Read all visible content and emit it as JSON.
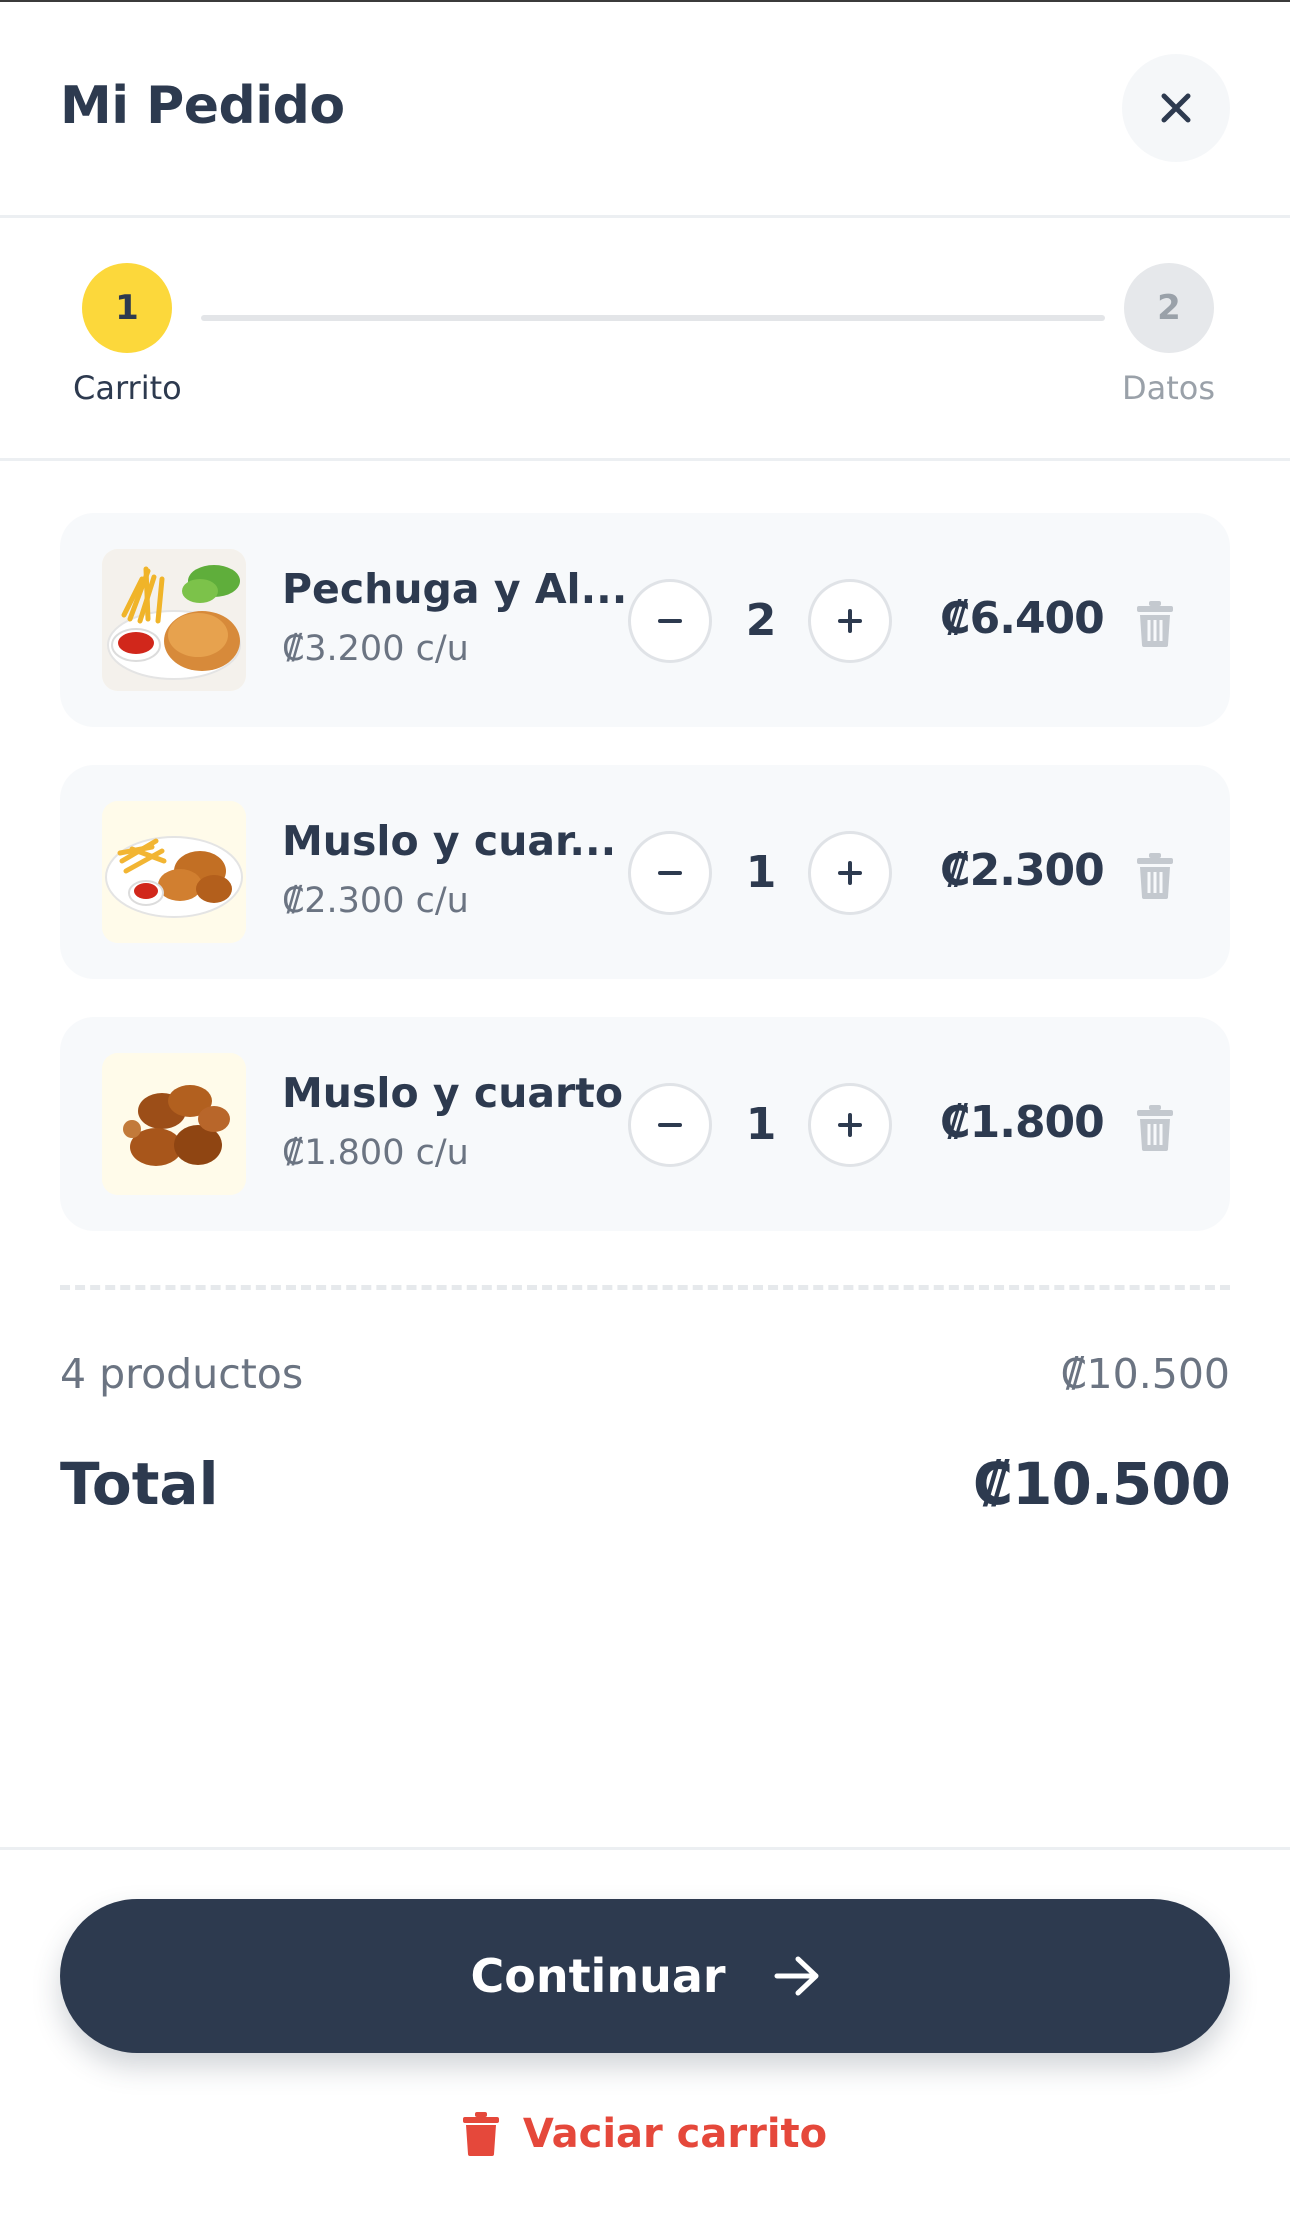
{
  "header": {
    "title": "Mi Pedido",
    "close_icon": "close-icon"
  },
  "stepper": {
    "steps": [
      {
        "number": "1",
        "label": "Carrito",
        "active": true,
        "color": "#fcd83b"
      },
      {
        "number": "2",
        "label": "Datos",
        "active": false,
        "color": "#e6e8eb"
      }
    ]
  },
  "cart": {
    "items": [
      {
        "name": "Pechuga y Al...",
        "unit_price": "₡3.200 c/u",
        "quantity": "2",
        "total": "₡6.400",
        "image": "chicken-breast-fries-icon"
      },
      {
        "name": "Muslo y cuar...",
        "unit_price": "₡2.300 c/u",
        "quantity": "1",
        "total": "₡2.300",
        "image": "chicken-thigh-fries-icon"
      },
      {
        "name": "Muslo y cuarto",
        "unit_price": "₡1.800 c/u",
        "quantity": "1",
        "total": "₡1.800",
        "image": "fried-chicken-icon"
      }
    ],
    "minus_label": "−",
    "plus_label": "+"
  },
  "summary": {
    "count_label": "4 productos",
    "subtotal": "₡10.500",
    "total_label": "Total",
    "total_value": "₡10.500"
  },
  "actions": {
    "continue_label": "Continuar",
    "empty_label": "Vaciar carrito"
  },
  "colors": {
    "primary": "#2d3a4f",
    "accent_yellow": "#fcd83b",
    "danger": "#e5483b",
    "muted": "#6b7482"
  }
}
